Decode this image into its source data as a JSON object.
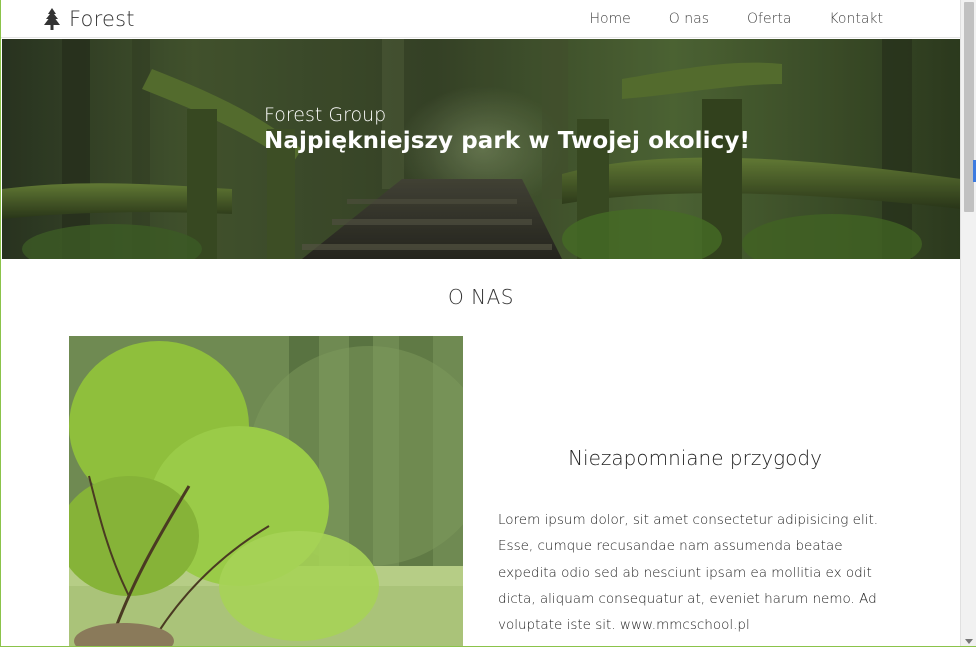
{
  "navbar": {
    "brand": {
      "icon": "tree-icon",
      "label": "Forest"
    },
    "links": [
      {
        "label": "Home"
      },
      {
        "label": "O nas"
      },
      {
        "label": "Oferta"
      },
      {
        "label": "Kontakt"
      }
    ]
  },
  "hero": {
    "subtitle": "Forest Group",
    "title": "Najpiękniejszy park w Twojej okolicy!"
  },
  "about": {
    "section_title": "O NAS",
    "heading": "Niezapomniane przygody",
    "body": "Lorem ipsum dolor, sit amet consectetur adipisicing elit. Esse, cumque recusandae nam assumenda beatae expedita odio sed ab nesciunt ipsam ea mollitia ex odit dicta, aliquam consequatur at, eveniet harum nemo. Ad voluptate iste sit. www.mmcschool.pl"
  },
  "colors": {
    "accent_border": "#8bc34a",
    "hero_overlay": "#2e3a24"
  }
}
